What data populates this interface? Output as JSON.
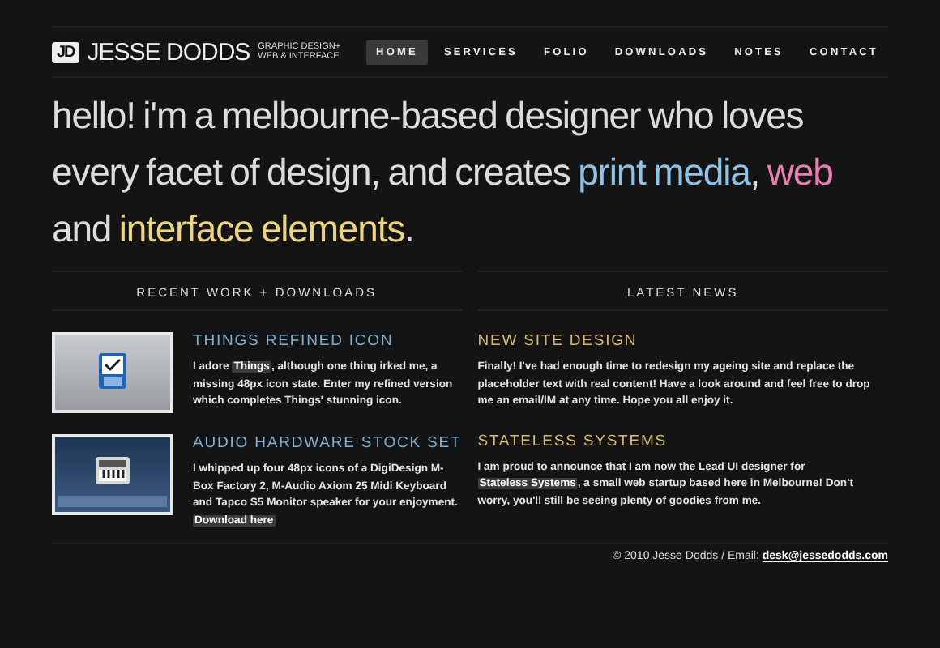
{
  "logo": {
    "mark": "JD",
    "name": "JESSE DODDS",
    "tagline": [
      "GRAPHIC DESIGN+",
      "WEB & INTERFACE"
    ]
  },
  "nav": [
    {
      "label": "HOME",
      "selected": true
    },
    {
      "label": "SERVICES",
      "selected": false
    },
    {
      "label": "FOLIO",
      "selected": false
    },
    {
      "label": "DOWNLOADS",
      "selected": false
    },
    {
      "label": "NOTES",
      "selected": false
    },
    {
      "label": "CONTACT",
      "selected": false
    }
  ],
  "headline": [
    {
      "text": "hello! i'm a melbourne-based designer who loves every facet of design, and creates "
    },
    {
      "text": "print media",
      "color": "#8ec3e6"
    },
    {
      "text": ", "
    },
    {
      "text": "web",
      "color": "#e77fb0"
    },
    {
      "text": " and "
    },
    {
      "text": "interface elements",
      "color": "#ecd57a"
    },
    {
      "text": "."
    }
  ],
  "columns": [
    {
      "heading": "RECENT WORK + DOWNLOADS",
      "kind": "work",
      "items": [
        {
          "title": "THINGS REFINED ICON",
          "body": [
            {
              "text": "I adore "
            },
            {
              "text": "Things",
              "kind": "link"
            },
            {
              "text": ", although one thing irked me, a missing 48px icon state. Enter my refined version which completes Things' stunning icon."
            }
          ]
        },
        {
          "title": "AUDIO HARDWARE STOCK SET",
          "body": [
            {
              "text": "I whipped up four 48px icons of a DigiDesign M-Box Factory 2, M-Audio Axiom 25 Midi Keyboard and Tapco S5 Monitor speaker for your enjoyment. "
            },
            {
              "text": "Download here",
              "kind": "link"
            }
          ]
        }
      ]
    },
    {
      "heading": "LATEST NEWS",
      "kind": "news",
      "items": [
        {
          "title": "NEW SITE DESIGN",
          "body": [
            {
              "text": "Finally! I've had enough time to redesign my ageing site and replace the placeholder text with real content! Have a look around and feel free to drop me an email/IM at any time. Hope you all enjoy it."
            }
          ]
        },
        {
          "title": "STATELESS SYSTEMS",
          "body": [
            {
              "text": "I am proud to announce that I am now the Lead UI designer for "
            },
            {
              "text": "Stateless Systems",
              "kind": "link"
            },
            {
              "text": ", a small web startup based here in Melbourne! Don't worry, you'll still be seeing plenty of goodies from me."
            }
          ]
        }
      ]
    }
  ],
  "footer": {
    "text": "© 2010 Jesse Dodds / Email: ",
    "email": "desk@jessedodds.com"
  }
}
